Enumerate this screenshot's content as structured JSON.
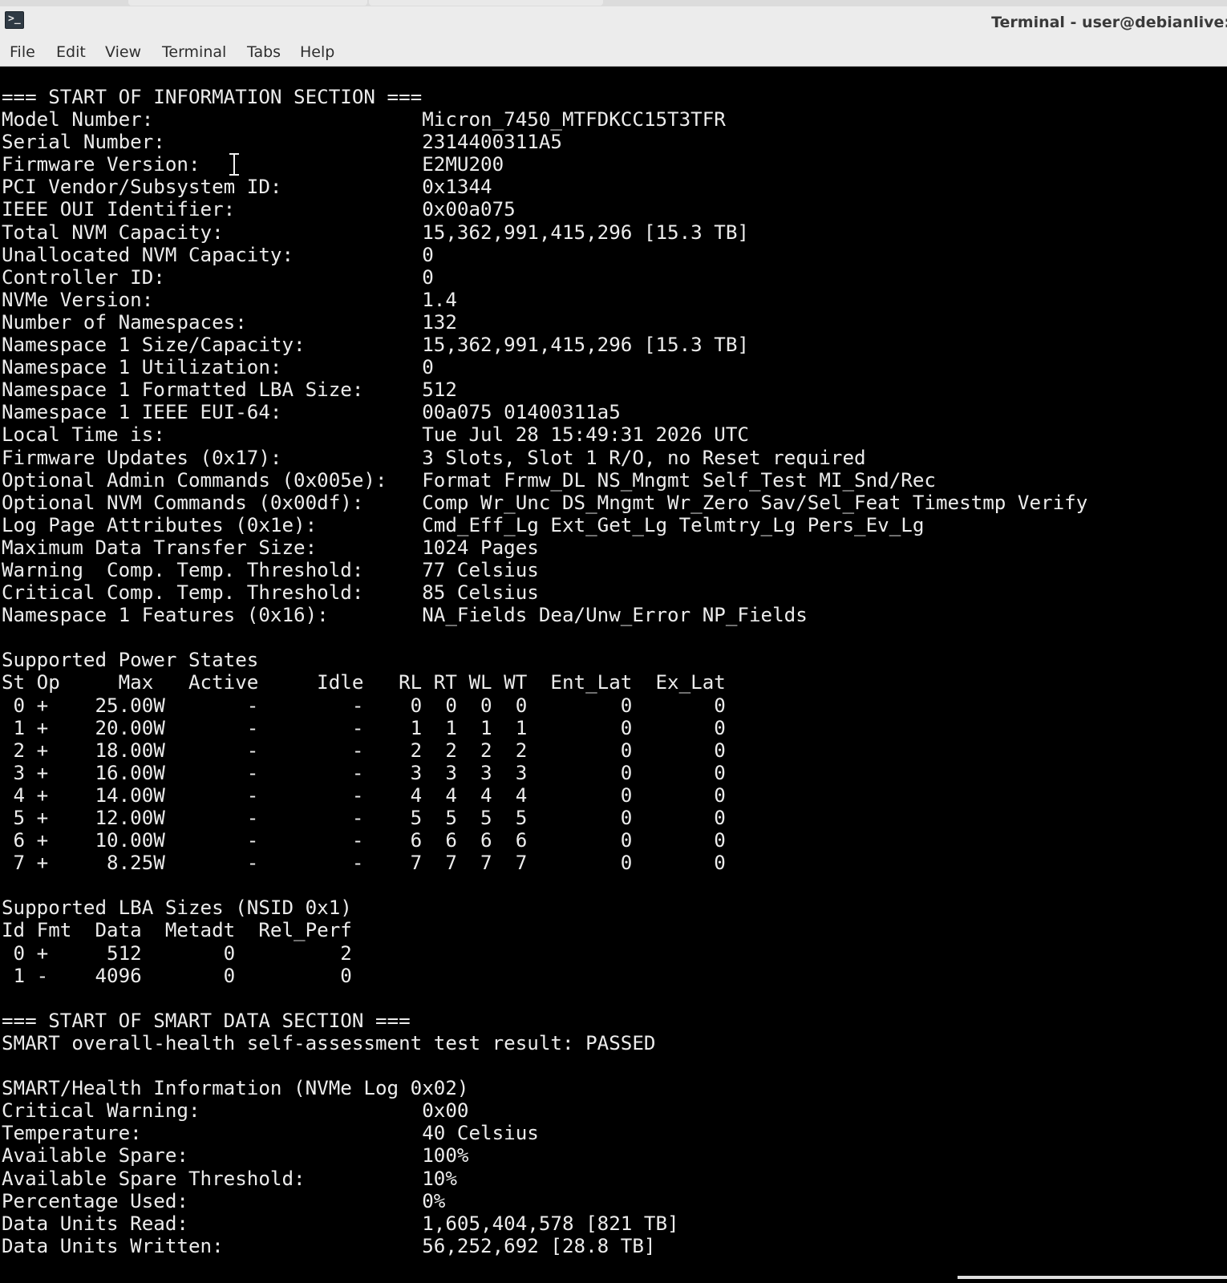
{
  "window": {
    "title": "Terminal - user@debianlive:"
  },
  "menubar": {
    "items": [
      "File",
      "Edit",
      "View",
      "Terminal",
      "Tabs",
      "Help"
    ]
  },
  "terminal": {
    "lines": [
      "=== START OF INFORMATION SECTION ===",
      "Model Number:                       Micron_7450_MTFDKCC15T3TFR",
      "Serial Number:                      2314400311A5",
      "Firmware Version:                   E2MU200",
      "PCI Vendor/Subsystem ID:            0x1344",
      "IEEE OUI Identifier:                0x00a075",
      "Total NVM Capacity:                 15,362,991,415,296 [15.3 TB]",
      "Unallocated NVM Capacity:           0",
      "Controller ID:                      0",
      "NVMe Version:                       1.4",
      "Number of Namespaces:               132",
      "Namespace 1 Size/Capacity:          15,362,991,415,296 [15.3 TB]",
      "Namespace 1 Utilization:            0",
      "Namespace 1 Formatted LBA Size:     512",
      "Namespace 1 IEEE EUI-64:            00a075 01400311a5",
      "Local Time is:                      Tue Jul 28 15:49:31 2026 UTC",
      "Firmware Updates (0x17):            3 Slots, Slot 1 R/O, no Reset required",
      "Optional Admin Commands (0x005e):   Format Frmw_DL NS_Mngmt Self_Test MI_Snd/Rec",
      "Optional NVM Commands (0x00df):     Comp Wr_Unc DS_Mngmt Wr_Zero Sav/Sel_Feat Timestmp Verify",
      "Log Page Attributes (0x1e):         Cmd_Eff_Lg Ext_Get_Lg Telmtry_Lg Pers_Ev_Lg",
      "Maximum Data Transfer Size:         1024 Pages",
      "Warning  Comp. Temp. Threshold:     77 Celsius",
      "Critical Comp. Temp. Threshold:     85 Celsius",
      "Namespace 1 Features (0x16):        NA_Fields Dea/Unw_Error NP_Fields",
      "",
      "Supported Power States",
      "St Op     Max   Active     Idle   RL RT WL WT  Ent_Lat  Ex_Lat",
      " 0 +    25.00W       -        -    0  0  0  0        0       0",
      " 1 +    20.00W       -        -    1  1  1  1        0       0",
      " 2 +    18.00W       -        -    2  2  2  2        0       0",
      " 3 +    16.00W       -        -    3  3  3  3        0       0",
      " 4 +    14.00W       -        -    4  4  4  4        0       0",
      " 5 +    12.00W       -        -    5  5  5  5        0       0",
      " 6 +    10.00W       -        -    6  6  6  6        0       0",
      " 7 +     8.25W       -        -    7  7  7  7        0       0",
      "",
      "Supported LBA Sizes (NSID 0x1)",
      "Id Fmt  Data  Metadt  Rel_Perf",
      " 0 +     512       0         2",
      " 1 -    4096       0         0",
      "",
      "=== START OF SMART DATA SECTION ===",
      "SMART overall-health self-assessment test result: PASSED",
      "",
      "SMART/Health Information (NVMe Log 0x02)",
      "Critical Warning:                   0x00",
      "Temperature:                        40 Celsius",
      "Available Spare:                    100%",
      "Available Spare Threshold:          10%",
      "Percentage Used:                    0%",
      "Data Units Read:                    1,605,404,578 [821 TB]",
      "Data Units Written:                 56,252,692 [28.8 TB]"
    ]
  },
  "colors": {
    "terminal_bg": "#000000",
    "terminal_fg": "#ececec",
    "chrome_bg": "#ececec"
  },
  "icons": {
    "app": "terminal-icon",
    "cursor": "ibeam-cursor-icon"
  }
}
